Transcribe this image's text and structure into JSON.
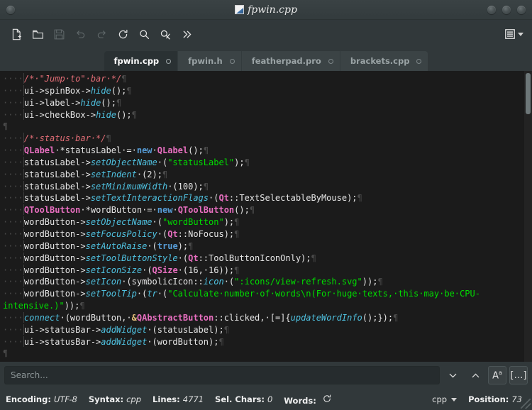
{
  "window": {
    "title": "fpwin.cpp",
    "app_icon": "feather-icon",
    "buttons": [
      "minimize-button",
      "maximize-button",
      "close-button"
    ]
  },
  "toolbar": {
    "items": [
      {
        "name": "new-file-button",
        "icon": "new-file-icon",
        "enabled": true,
        "tooltip": "New"
      },
      {
        "name": "open-file-button",
        "icon": "open-folder-icon",
        "enabled": true,
        "tooltip": "Open"
      },
      {
        "name": "save-file-button",
        "icon": "save-disk-icon",
        "enabled": false,
        "tooltip": "Save"
      },
      {
        "name": "undo-button",
        "icon": "undo-arrow-icon",
        "enabled": false,
        "tooltip": "Undo"
      },
      {
        "name": "redo-button",
        "icon": "redo-arrow-icon",
        "enabled": false,
        "tooltip": "Redo"
      },
      {
        "name": "reload-button",
        "icon": "reload-icon",
        "enabled": true,
        "tooltip": "Reload"
      },
      {
        "name": "find-button",
        "icon": "search-icon",
        "enabled": true,
        "tooltip": "Find"
      },
      {
        "name": "replace-button",
        "icon": "replace-icon",
        "enabled": true,
        "tooltip": "Replace"
      },
      {
        "name": "more-button",
        "icon": "chevron-double-right-icon",
        "enabled": true,
        "tooltip": "More"
      }
    ],
    "menu_button": {
      "name": "main-menu-button",
      "icon": "hamburger-menu-icon"
    }
  },
  "tabs": [
    {
      "label": "fpwin.cpp",
      "active": true
    },
    {
      "label": "fpwin.h",
      "active": false
    },
    {
      "label": "featherpad.pro",
      "active": false
    },
    {
      "label": "brackets.cpp",
      "active": false
    }
  ],
  "editor": {
    "lines": [
      {
        "indent": 4,
        "guide": true,
        "tokens": [
          {
            "t": "/* \"Jump to\" bar */",
            "c": "c-cmt"
          }
        ]
      },
      {
        "indent": 4,
        "guide": true,
        "tokens": [
          {
            "t": "ui->spinBox->",
            "c": "c-plain"
          },
          {
            "t": "hide",
            "c": "c-fn"
          },
          {
            "t": "();",
            "c": "c-plain"
          }
        ]
      },
      {
        "indent": 4,
        "guide": true,
        "tokens": [
          {
            "t": "ui->label->",
            "c": "c-plain"
          },
          {
            "t": "hide",
            "c": "c-fn"
          },
          {
            "t": "();",
            "c": "c-plain"
          }
        ]
      },
      {
        "indent": 4,
        "guide": true,
        "tokens": [
          {
            "t": "ui->checkBox->",
            "c": "c-plain"
          },
          {
            "t": "hide",
            "c": "c-fn"
          },
          {
            "t": "();",
            "c": "c-plain"
          }
        ]
      },
      {
        "indent": 0,
        "guide": false,
        "tokens": []
      },
      {
        "indent": 4,
        "guide": true,
        "tokens": [
          {
            "t": "/* status bar */",
            "c": "c-cmt"
          }
        ]
      },
      {
        "indent": 4,
        "guide": true,
        "tokens": [
          {
            "t": "QLabel",
            "c": "c-type"
          },
          {
            "t": " *statusLabel = ",
            "c": "c-plain"
          },
          {
            "t": "new",
            "c": "c-kw"
          },
          {
            "t": " ",
            "c": "c-plain"
          },
          {
            "t": "QLabel",
            "c": "c-type"
          },
          {
            "t": "();",
            "c": "c-plain"
          }
        ]
      },
      {
        "indent": 4,
        "guide": true,
        "tokens": [
          {
            "t": "statusLabel->",
            "c": "c-plain"
          },
          {
            "t": "setObjectName",
            "c": "c-fn"
          },
          {
            "t": " (",
            "c": "c-plain"
          },
          {
            "t": "\"statusLabel\"",
            "c": "c-str"
          },
          {
            "t": ");",
            "c": "c-plain"
          }
        ]
      },
      {
        "indent": 4,
        "guide": true,
        "tokens": [
          {
            "t": "statusLabel->",
            "c": "c-plain"
          },
          {
            "t": "setIndent",
            "c": "c-fn"
          },
          {
            "t": " (2);",
            "c": "c-plain"
          }
        ]
      },
      {
        "indent": 4,
        "guide": true,
        "tokens": [
          {
            "t": "statusLabel->",
            "c": "c-plain"
          },
          {
            "t": "setMinimumWidth",
            "c": "c-fn"
          },
          {
            "t": " (100);",
            "c": "c-plain"
          }
        ]
      },
      {
        "indent": 4,
        "guide": true,
        "tokens": [
          {
            "t": "statusLabel->",
            "c": "c-plain"
          },
          {
            "t": "setTextInteractionFlags",
            "c": "c-fn"
          },
          {
            "t": " (",
            "c": "c-plain"
          },
          {
            "t": "Qt",
            "c": "c-type"
          },
          {
            "t": "::TextSelectableByMouse);",
            "c": "c-plain"
          }
        ]
      },
      {
        "indent": 4,
        "guide": true,
        "tokens": [
          {
            "t": "QToolButton",
            "c": "c-type"
          },
          {
            "t": " *wordButton = ",
            "c": "c-plain"
          },
          {
            "t": "new",
            "c": "c-kw"
          },
          {
            "t": " ",
            "c": "c-plain"
          },
          {
            "t": "QToolButton",
            "c": "c-type"
          },
          {
            "t": "();",
            "c": "c-plain"
          }
        ]
      },
      {
        "indent": 4,
        "guide": true,
        "tokens": [
          {
            "t": "wordButton->",
            "c": "c-plain"
          },
          {
            "t": "setObjectName",
            "c": "c-fn"
          },
          {
            "t": " (",
            "c": "c-plain"
          },
          {
            "t": "\"wordButton\"",
            "c": "c-str"
          },
          {
            "t": ");",
            "c": "c-plain"
          }
        ]
      },
      {
        "indent": 4,
        "guide": true,
        "tokens": [
          {
            "t": "wordButton->",
            "c": "c-plain"
          },
          {
            "t": "setFocusPolicy",
            "c": "c-fn"
          },
          {
            "t": " (",
            "c": "c-plain"
          },
          {
            "t": "Qt",
            "c": "c-type"
          },
          {
            "t": "::NoFocus);",
            "c": "c-plain"
          }
        ]
      },
      {
        "indent": 4,
        "guide": true,
        "tokens": [
          {
            "t": "wordButton->",
            "c": "c-plain"
          },
          {
            "t": "setAutoRaise",
            "c": "c-fn"
          },
          {
            "t": " (",
            "c": "c-plain"
          },
          {
            "t": "true",
            "c": "c-kw"
          },
          {
            "t": ");",
            "c": "c-plain"
          }
        ]
      },
      {
        "indent": 4,
        "guide": true,
        "tokens": [
          {
            "t": "wordButton->",
            "c": "c-plain"
          },
          {
            "t": "setToolButtonStyle",
            "c": "c-fn"
          },
          {
            "t": " (",
            "c": "c-plain"
          },
          {
            "t": "Qt",
            "c": "c-type"
          },
          {
            "t": "::ToolButtonIconOnly);",
            "c": "c-plain"
          }
        ]
      },
      {
        "indent": 4,
        "guide": true,
        "tokens": [
          {
            "t": "wordButton->",
            "c": "c-plain"
          },
          {
            "t": "setIconSize",
            "c": "c-fn"
          },
          {
            "t": " (",
            "c": "c-plain"
          },
          {
            "t": "QSize",
            "c": "c-type"
          },
          {
            "t": " (16, 16));",
            "c": "c-plain"
          }
        ]
      },
      {
        "indent": 4,
        "guide": true,
        "tokens": [
          {
            "t": "wordButton->",
            "c": "c-plain"
          },
          {
            "t": "setIcon",
            "c": "c-fn"
          },
          {
            "t": " (symbolicIcon::",
            "c": "c-plain"
          },
          {
            "t": "icon",
            "c": "c-fn"
          },
          {
            "t": " (",
            "c": "c-plain"
          },
          {
            "t": "\":icons/view-refresh.svg\"",
            "c": "c-str"
          },
          {
            "t": "));",
            "c": "c-plain"
          }
        ]
      },
      {
        "indent": 4,
        "guide": true,
        "tokens": [
          {
            "t": "wordButton->",
            "c": "c-plain"
          },
          {
            "t": "setToolTip",
            "c": "c-fn"
          },
          {
            "t": " (",
            "c": "c-plain"
          },
          {
            "t": "tr",
            "c": "c-fn"
          },
          {
            "t": " (",
            "c": "c-plain"
          },
          {
            "t": "\"Calculate number of words\\n(For huge texts, this may be CPU-intensive.)\"",
            "c": "c-str"
          },
          {
            "t": "));",
            "c": "c-plain"
          }
        ]
      },
      {
        "indent": 4,
        "guide": true,
        "tokens": [
          {
            "t": "connect",
            "c": "c-fn"
          },
          {
            "t": " (wordButton, ",
            "c": "c-plain"
          },
          {
            "t": "&",
            "c": "c-amp"
          },
          {
            "t": "QAbstractButton",
            "c": "c-type"
          },
          {
            "t": "::clicked, [=]{",
            "c": "c-plain"
          },
          {
            "t": "updateWordInfo",
            "c": "c-fn"
          },
          {
            "t": "();});",
            "c": "c-plain"
          }
        ]
      },
      {
        "indent": 4,
        "guide": true,
        "tokens": [
          {
            "t": "ui->statusBar->",
            "c": "c-plain"
          },
          {
            "t": "addWidget",
            "c": "c-fn"
          },
          {
            "t": " (statusLabel);",
            "c": "c-plain"
          }
        ]
      },
      {
        "indent": 4,
        "guide": true,
        "tokens": [
          {
            "t": "ui->statusBar->",
            "c": "c-plain"
          },
          {
            "t": "addWidget",
            "c": "c-fn"
          },
          {
            "t": " (wordButton);",
            "c": "c-plain"
          }
        ]
      },
      {
        "indent": 0,
        "guide": false,
        "tokens": []
      }
    ],
    "pilcrow": "¶",
    "space_dot": "·",
    "scrollbar": {
      "name": "vertical-scrollbar"
    }
  },
  "search": {
    "placeholder": "Search...",
    "value": "",
    "next_button": "find-next-button",
    "prev_button": "find-previous-button",
    "case_button_glyph": "A",
    "case_button_sup": "a",
    "whole_word_glyph": "[…]"
  },
  "statusbar": {
    "encoding_label": "Encoding:",
    "encoding_value": "UTF-8",
    "syntax_label": "Syntax:",
    "syntax_value": "cpp",
    "lines_label": "Lines:",
    "lines_value": "4771",
    "sel_label": "Sel. Chars:",
    "sel_value": "0",
    "words_label": "Words:",
    "words_refresh_icon": "reload-icon",
    "language": "cpp",
    "position_label": "Position:",
    "position_value": "73"
  },
  "colors": {
    "chrome": "#31383a",
    "titlebar": "#3a4244",
    "editor_bg": "#1b1b1b",
    "tab_active_bg": "#2a3133",
    "tab_inactive_bg": "#3b4345",
    "comment": "#e06c75",
    "type": "#e86fc0",
    "keyword": "#569cd6",
    "function": "#4fc1e0",
    "string": "#00dd00",
    "text": "#e6e6e6"
  }
}
